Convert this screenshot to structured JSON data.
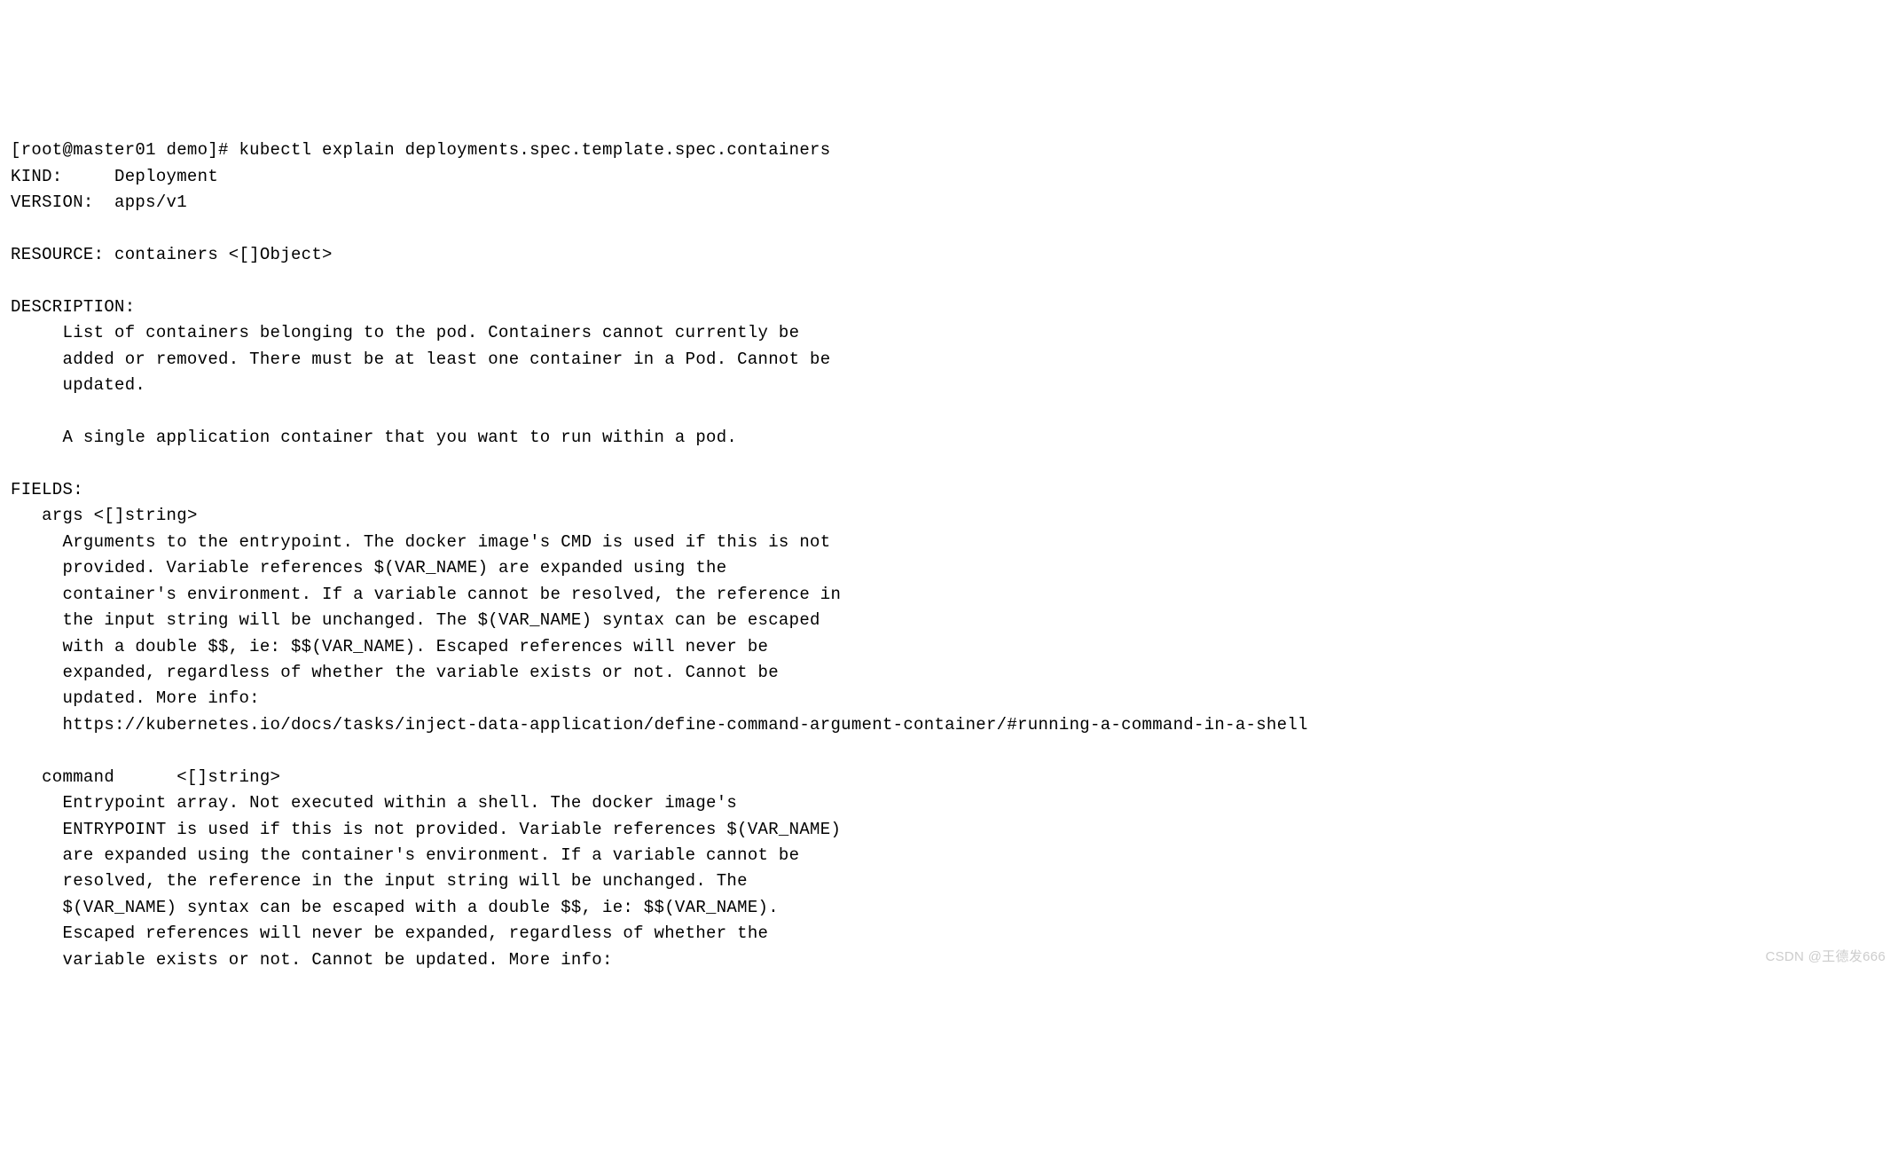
{
  "terminal": {
    "prompt_line": "[root@master01 demo]# kubectl explain deployments.spec.template.spec.containers",
    "kind_line": "KIND:     Deployment",
    "version_line": "VERSION:  apps/v1",
    "resource_line": "RESOURCE: containers <[]Object>",
    "description_header": "DESCRIPTION:",
    "description_line1": "     List of containers belonging to the pod. Containers cannot currently be",
    "description_line2": "     added or removed. There must be at least one container in a Pod. Cannot be",
    "description_line3": "     updated.",
    "description_line4": "     A single application container that you want to run within a pod.",
    "fields_header": "FIELDS:",
    "args_header": "   args\t<[]string>",
    "args_line1": "     Arguments to the entrypoint. The docker image's CMD is used if this is not",
    "args_line2": "     provided. Variable references $(VAR_NAME) are expanded using the",
    "args_line3": "     container's environment. If a variable cannot be resolved, the reference in",
    "args_line4": "     the input string will be unchanged. The $(VAR_NAME) syntax can be escaped",
    "args_line5": "     with a double $$, ie: $$(VAR_NAME). Escaped references will never be",
    "args_line6": "     expanded, regardless of whether the variable exists or not. Cannot be",
    "args_line7": "     updated. More info:",
    "args_line8": "     https://kubernetes.io/docs/tasks/inject-data-application/define-command-argument-container/#running-a-command-in-a-shell",
    "command_header": "   command\t<[]string>",
    "command_line1": "     Entrypoint array. Not executed within a shell. The docker image's",
    "command_line2": "     ENTRYPOINT is used if this is not provided. Variable references $(VAR_NAME)",
    "command_line3": "     are expanded using the container's environment. If a variable cannot be",
    "command_line4": "     resolved, the reference in the input string will be unchanged. The",
    "command_line5": "     $(VAR_NAME) syntax can be escaped with a double $$, ie: $$(VAR_NAME).",
    "command_line6": "     Escaped references will never be expanded, regardless of whether the",
    "command_line7": "     variable exists or not. Cannot be updated. More info:"
  },
  "watermark": "CSDN @王德发666"
}
